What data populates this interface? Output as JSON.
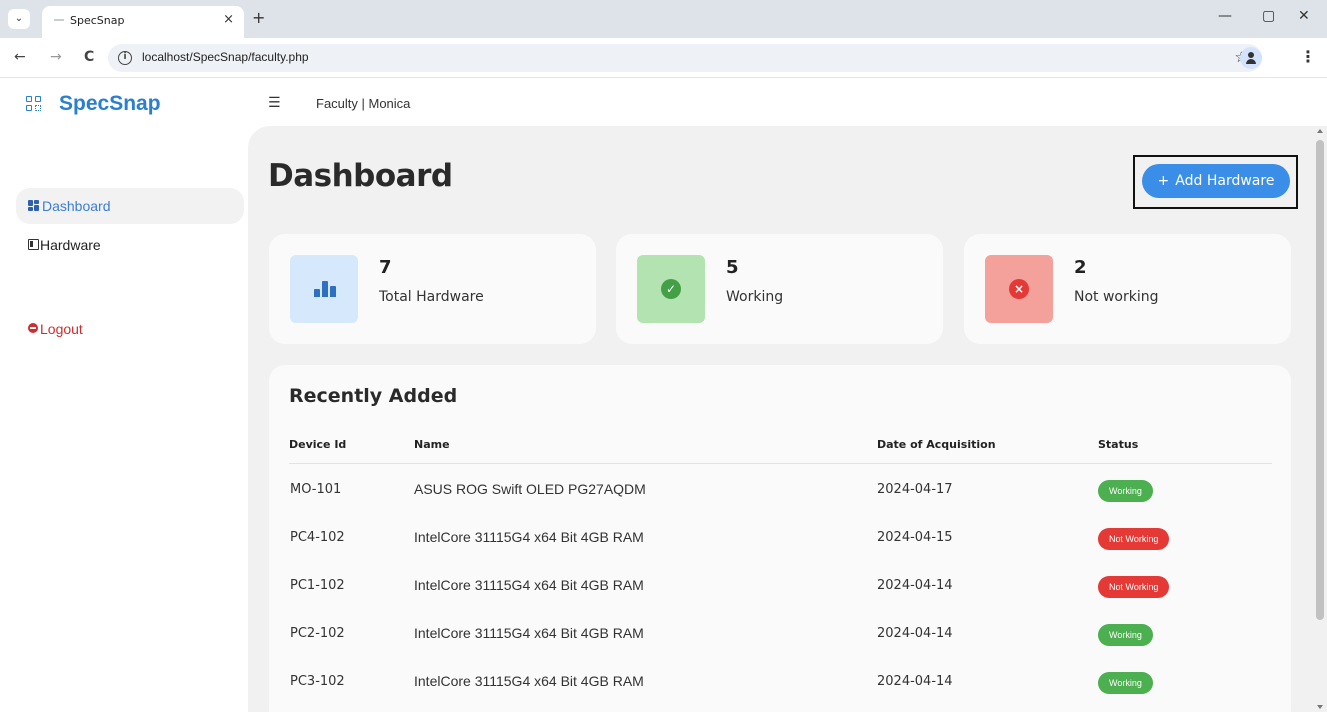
{
  "browser": {
    "tab_title": "SpecSnap",
    "tab_close": "×",
    "new_tab": "+",
    "url": "localhost/SpecSnap/faculty.php",
    "nav": {
      "back": "←",
      "forward": "→",
      "reload": "C"
    },
    "window": {
      "minimize": "—",
      "maximize": "▢",
      "close": "✕"
    }
  },
  "app": {
    "brand": "SpecSnap",
    "breadcrumb": "Faculty | Monica",
    "sidebar": {
      "items": [
        {
          "label": "Dashboard",
          "icon": "dashboard-icon",
          "active": true
        },
        {
          "label": "Hardware",
          "icon": "hardware-icon",
          "active": false
        }
      ],
      "logout": {
        "label": "Logout",
        "icon": "logout-icon",
        "color": "#d02e2e"
      }
    },
    "page_title": "Dashboard",
    "add_button": {
      "plus": "+",
      "label": "Add Hardware",
      "color": "#3b8ee8"
    },
    "stats": [
      {
        "value": "7",
        "label": "Total Hardware",
        "icon": "bar-chart-icon",
        "bg": "#d6e8fb"
      },
      {
        "value": "5",
        "label": "Working",
        "icon": "check-circle-icon",
        "bg": "#b3e3b0"
      },
      {
        "value": "2",
        "label": "Not working",
        "icon": "x-circle-icon",
        "bg": "#f4a19c"
      }
    ],
    "recent": {
      "title": "Recently Added",
      "columns": [
        "Device Id",
        "Name",
        "Date of Acquisition",
        "Status"
      ],
      "rows": [
        {
          "id": "MO-101",
          "name": "ASUS ROG Swift OLED PG27AQDM",
          "date": "2024-04-17",
          "status": "Working"
        },
        {
          "id": "PC4-102",
          "name": "IntelCore 31115G4 x64 Bit 4GB RAM",
          "date": "2024-04-15",
          "status": "Not Working"
        },
        {
          "id": "PC1-102",
          "name": "IntelCore 31115G4 x64 Bit 4GB RAM",
          "date": "2024-04-14",
          "status": "Not Working"
        },
        {
          "id": "PC2-102",
          "name": "IntelCore 31115G4 x64 Bit 4GB RAM",
          "date": "2024-04-14",
          "status": "Working"
        },
        {
          "id": "PC3-102",
          "name": "IntelCore 31115G4 x64 Bit 4GB RAM",
          "date": "2024-04-14",
          "status": "Working"
        }
      ]
    },
    "status_colors": {
      "Working": "#4caf50",
      "Not Working": "#e53935"
    }
  }
}
